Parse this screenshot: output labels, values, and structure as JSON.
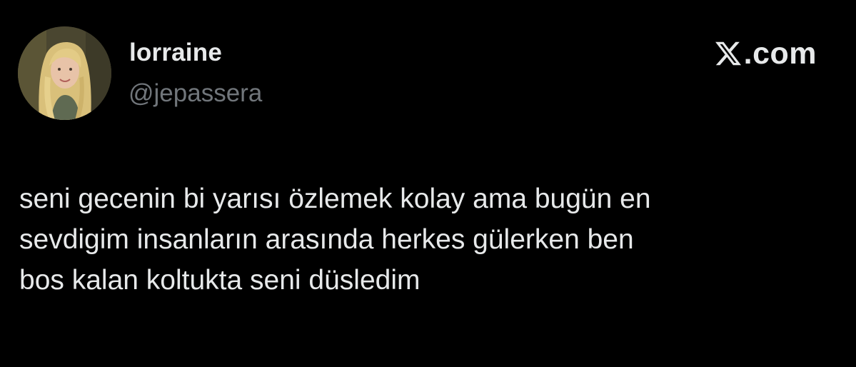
{
  "author": {
    "display_name": "lorraine",
    "handle": "@jepassera",
    "avatar_icon": "profile-photo"
  },
  "brand": {
    "icon": "x-logo-icon",
    "label": ".com"
  },
  "tweet": {
    "lines": [
      "seni gecenin bi yarısı özlemek kolay ama bugün en",
      "sevdigim insanların arasında herkes gülerken ben",
      "bos kalan koltukta seni düsledim"
    ]
  },
  "colors": {
    "background": "#000000",
    "primary_text": "#e7e9ea",
    "secondary_text": "#71767b"
  }
}
